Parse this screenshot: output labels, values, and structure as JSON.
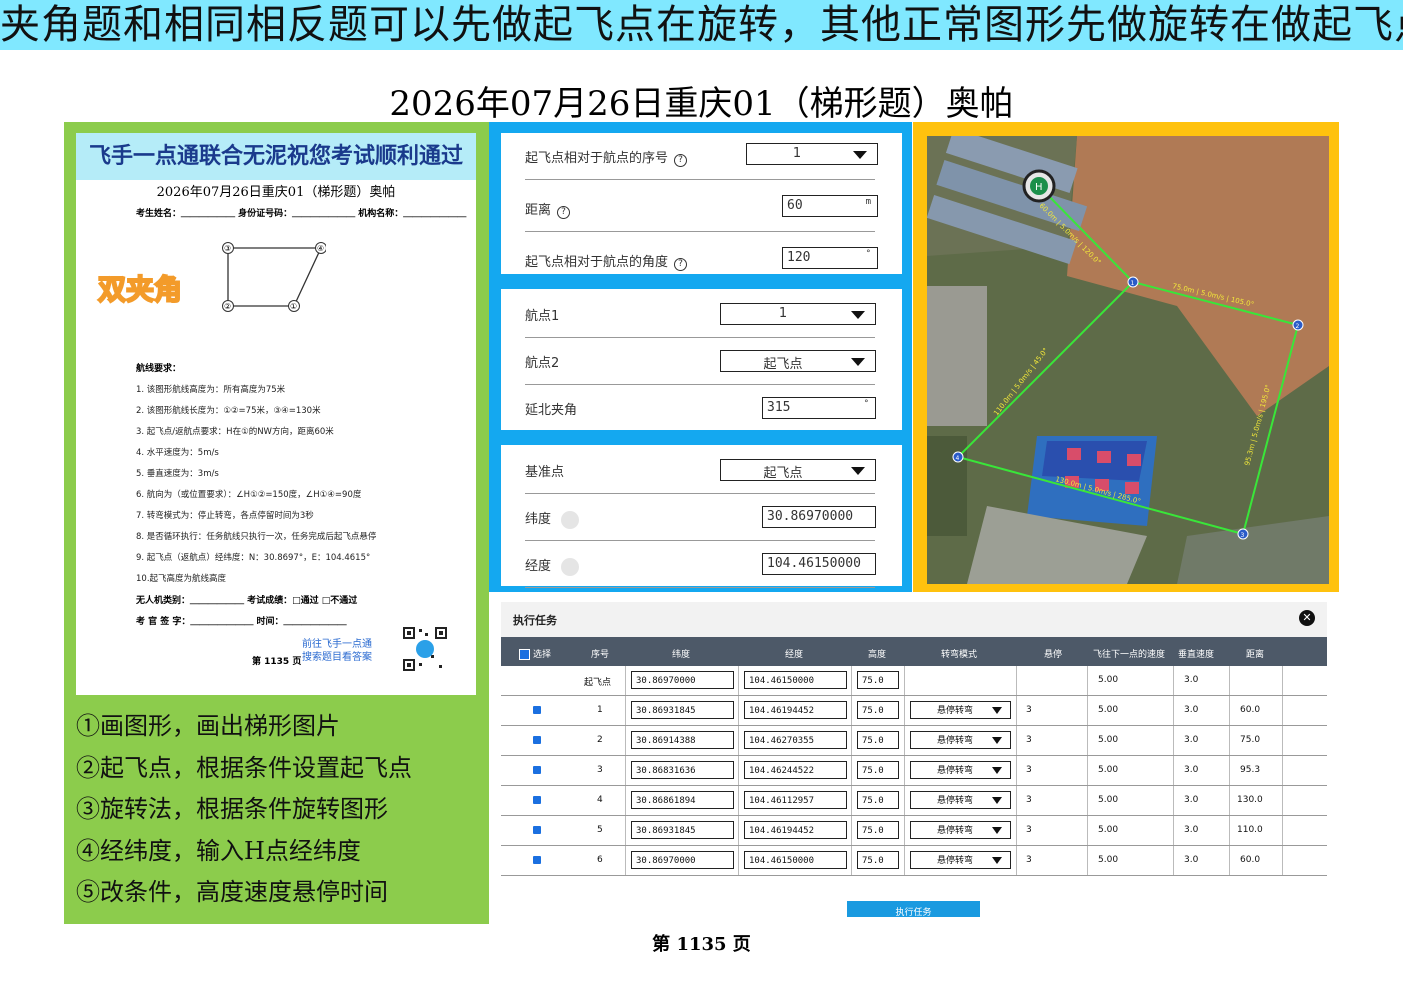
{
  "banner": "夹角题和相同相反题可以先做起飞点在旋转，其他正常图形先做旋转在做起飞点",
  "title": "2026年07月26日重庆01（梯形题）奥帕",
  "paper": {
    "header": "飞手一点通联合无泥祝您考试顺利通过",
    "title": "2026年07月26日重庆01（梯形题）奥帕",
    "info_line": "考生姓名：＿＿＿＿＿＿ 身份证号码：＿＿＿＿＿＿＿ 机构名称：＿＿＿＿＿＿＿",
    "badge": "双夹角",
    "req_heading": "航线要求：",
    "requirements": [
      "1. 该图形航线高度为：所有高度为75米",
      "2. 该图形航线长度为：①②=75米，③④=130米",
      "3. 起飞点/返航点要求：H在①的NW方向，距离60米",
      "4. 水平速度为：5m/s",
      "5. 垂直速度为：3m/s",
      "6. 航向为（或位置要求）：∠H①②=150度，∠H①④=90度",
      "7. 转弯模式为：停止转弯，各点停留时间为3秒",
      "8. 是否循环执行：任务航线只执行一次，任务完成后起飞点悬停",
      "9. 起飞点（返航点）经纬度：N：30.8697°，E：104.4615°",
      "10.起飞高度为航线高度"
    ],
    "footer_type": "无人机类别：＿＿＿＿＿＿ 考试成绩：□通过 □不通过",
    "footer_sign": "考 官 签 字：＿＿＿＿＿＿＿ 时间：＿＿＿＿＿＿＿",
    "qr_text_1": "前往飞手一点通",
    "qr_text_2": "搜索题目看答案",
    "page": "第 1135 页",
    "shape_labels": [
      "③",
      "④",
      "②",
      "①"
    ]
  },
  "steps": [
    "①画图形，画出梯形图片",
    "②起飞点，根据条件设置起飞点",
    "③旋转法，根据条件旋转图形",
    "④经纬度，输入H点经纬度",
    "⑤改条件，高度速度悬停时间"
  ],
  "takeoff_form": {
    "seq_label": "起飞点相对于航点的序号",
    "seq_value": "1",
    "dist_label": "距离",
    "dist_value": "60",
    "dist_unit": "m",
    "angle_label": "起飞点相对于航点的角度",
    "angle_value": "120",
    "angle_unit": "°"
  },
  "rotate_form": {
    "wp1_label": "航点1",
    "wp1_value": "1",
    "wp2_label": "航点2",
    "wp2_value": "起飞点",
    "angle_label": "延北夹角",
    "angle_value": "315",
    "angle_unit": "°"
  },
  "coord_form": {
    "base_label": "基准点",
    "base_value": "起飞点",
    "lat_label": "纬度",
    "lat_value": "30.86970000",
    "lon_label": "经度",
    "lon_value": "104.46150000"
  },
  "map": {
    "seg_labels": [
      "60.0m | 5.0m/s | 120.0°",
      "75.0m | 5.0m/s | 105.0°",
      "95.3m | 5.0m/s | 195.0°",
      "130.0m | 5.0m/s | 285.0°",
      "110.0m | 5.0m/s | 45.0°"
    ],
    "wp_labels": [
      "H",
      "1",
      "2",
      "3",
      "4"
    ]
  },
  "task": {
    "title": "执行任务",
    "close": "✕",
    "headers": [
      "选择",
      "序号",
      "纬度",
      "经度",
      "高度",
      "转弯模式",
      "悬停",
      "飞往下一点的速度",
      "垂直速度",
      "距离"
    ],
    "takeoff_row": {
      "seq": "起飞点",
      "lat": "30.86970000",
      "lon": "104.46150000",
      "alt": "75.0",
      "speed": "5.00",
      "vspeed": "3.0"
    },
    "rows": [
      {
        "seq": "1",
        "lat": "30.86931845",
        "lon": "104.46194452",
        "alt": "75.0",
        "mode": "悬停转弯",
        "hover": "3",
        "speed": "5.00",
        "vspeed": "3.0",
        "dist": "60.0"
      },
      {
        "seq": "2",
        "lat": "30.86914388",
        "lon": "104.46270355",
        "alt": "75.0",
        "mode": "悬停转弯",
        "hover": "3",
        "speed": "5.00",
        "vspeed": "3.0",
        "dist": "75.0"
      },
      {
        "seq": "3",
        "lat": "30.86831636",
        "lon": "104.46244522",
        "alt": "75.0",
        "mode": "悬停转弯",
        "hover": "3",
        "speed": "5.00",
        "vspeed": "3.0",
        "dist": "95.3"
      },
      {
        "seq": "4",
        "lat": "30.86861894",
        "lon": "104.46112957",
        "alt": "75.0",
        "mode": "悬停转弯",
        "hover": "3",
        "speed": "5.00",
        "vspeed": "3.0",
        "dist": "130.0"
      },
      {
        "seq": "5",
        "lat": "30.86931845",
        "lon": "104.46194452",
        "alt": "75.0",
        "mode": "悬停转弯",
        "hover": "3",
        "speed": "5.00",
        "vspeed": "3.0",
        "dist": "110.0"
      },
      {
        "seq": "6",
        "lat": "30.86970000",
        "lon": "104.46150000",
        "alt": "75.0",
        "mode": "悬停转弯",
        "hover": "3",
        "speed": "5.00",
        "vspeed": "3.0",
        "dist": "60.0"
      }
    ],
    "exec_button": "执行任务"
  },
  "page_number": "第 1135 页",
  "colors": {
    "banner": "#80e8ff",
    "green": "#8ccc4c",
    "blue": "#14a8f0",
    "orange": "#ffc20e",
    "route": "#39e639",
    "table_header": "#4d5968"
  }
}
